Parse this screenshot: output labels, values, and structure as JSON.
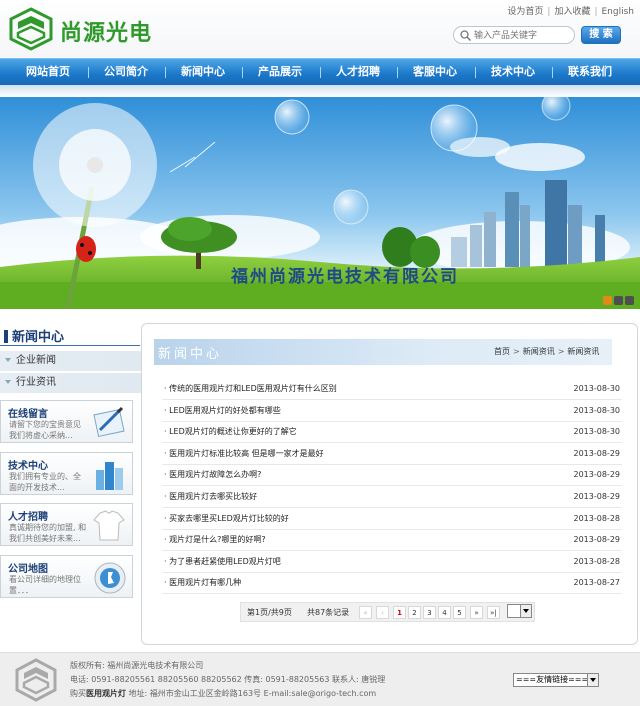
{
  "header": {
    "brand": "尚源光电",
    "top_links": [
      "设为首页",
      "加入收藏",
      "English"
    ],
    "search_placeholder": "输入产品关键字",
    "search_button": "搜 索"
  },
  "nav": [
    "网站首页",
    "公司简介",
    "新闻中心",
    "产品展示",
    "人才招聘",
    "客服中心",
    "技术中心",
    "联系我们"
  ],
  "banner": {
    "title": "福州尚源光电技术有限公司"
  },
  "sidebar": {
    "title": "新闻中心",
    "menu": [
      "企业新闻",
      "行业资讯"
    ],
    "cards": [
      {
        "title": "在线留言",
        "desc": "请留下您的宝贵意见 我们将虚心采纳..."
      },
      {
        "title": "技术中心",
        "desc": "我们拥有专业的、全 面的开发技术..."
      },
      {
        "title": "人才招聘",
        "desc": "真诚期待您的加盟, 和我们共创美好未来..."
      },
      {
        "title": "公司地图",
        "desc": "看公司详细的地理位置．．．"
      }
    ]
  },
  "main": {
    "title": "新闻中心",
    "breadcrumb": [
      "首页",
      "新闻资讯",
      "新闻资讯"
    ],
    "news": [
      {
        "title": "· 传统的医用观片灯和LED医用观片灯有什么区别",
        "date": "2013-08-30"
      },
      {
        "title": "·  LED医用观片灯的好处都有哪些",
        "date": "2013-08-30"
      },
      {
        "title": "· LED观片灯的概述让你更好的了解它",
        "date": "2013-08-30"
      },
      {
        "title": "· 医用观片灯标准比较高 但是哪一家才是最好",
        "date": "2013-08-29"
      },
      {
        "title": "· 医用观片灯故障怎么办啊?",
        "date": "2013-08-29"
      },
      {
        "title": "· 医用观片灯去哪买比较好",
        "date": "2013-08-29"
      },
      {
        "title": "· 买家去哪里买LED观片灯比较的好",
        "date": "2013-08-28"
      },
      {
        "title": "· 观片灯是什么?哪里的好啊?",
        "date": "2013-08-29"
      },
      {
        "title": "· 为了患者赶紧使用LED观片灯吧",
        "date": "2013-08-28"
      },
      {
        "title": "· 医用观片灯有哪几种",
        "date": "2013-08-27"
      }
    ],
    "pager": {
      "page_info": "第1页/共9页",
      "total": "共87条记录",
      "first": "«",
      "prev": "‹",
      "pages": [
        "1",
        "2",
        "3",
        "4",
        "5"
      ],
      "next": "»",
      "last": "»|"
    }
  },
  "footer": {
    "copyright": "版权所有: 福州尚源光电技术有限公司",
    "contact": "电话: 0591-88205561 88205560 88205562  传真: 0591-88205563  联系人: 唐锐理",
    "buy_prefix": "购买",
    "buy_em": "医用观片灯",
    "address": "  地址: 福州市金山工业区金岭路163号  E-mail:sale@origo-tech.com",
    "friend_links": "===友情链接==="
  },
  "colors": {
    "nav": "#1b77c9",
    "brand_green": "#2f9a2b",
    "side_title": "#1d3f78"
  }
}
